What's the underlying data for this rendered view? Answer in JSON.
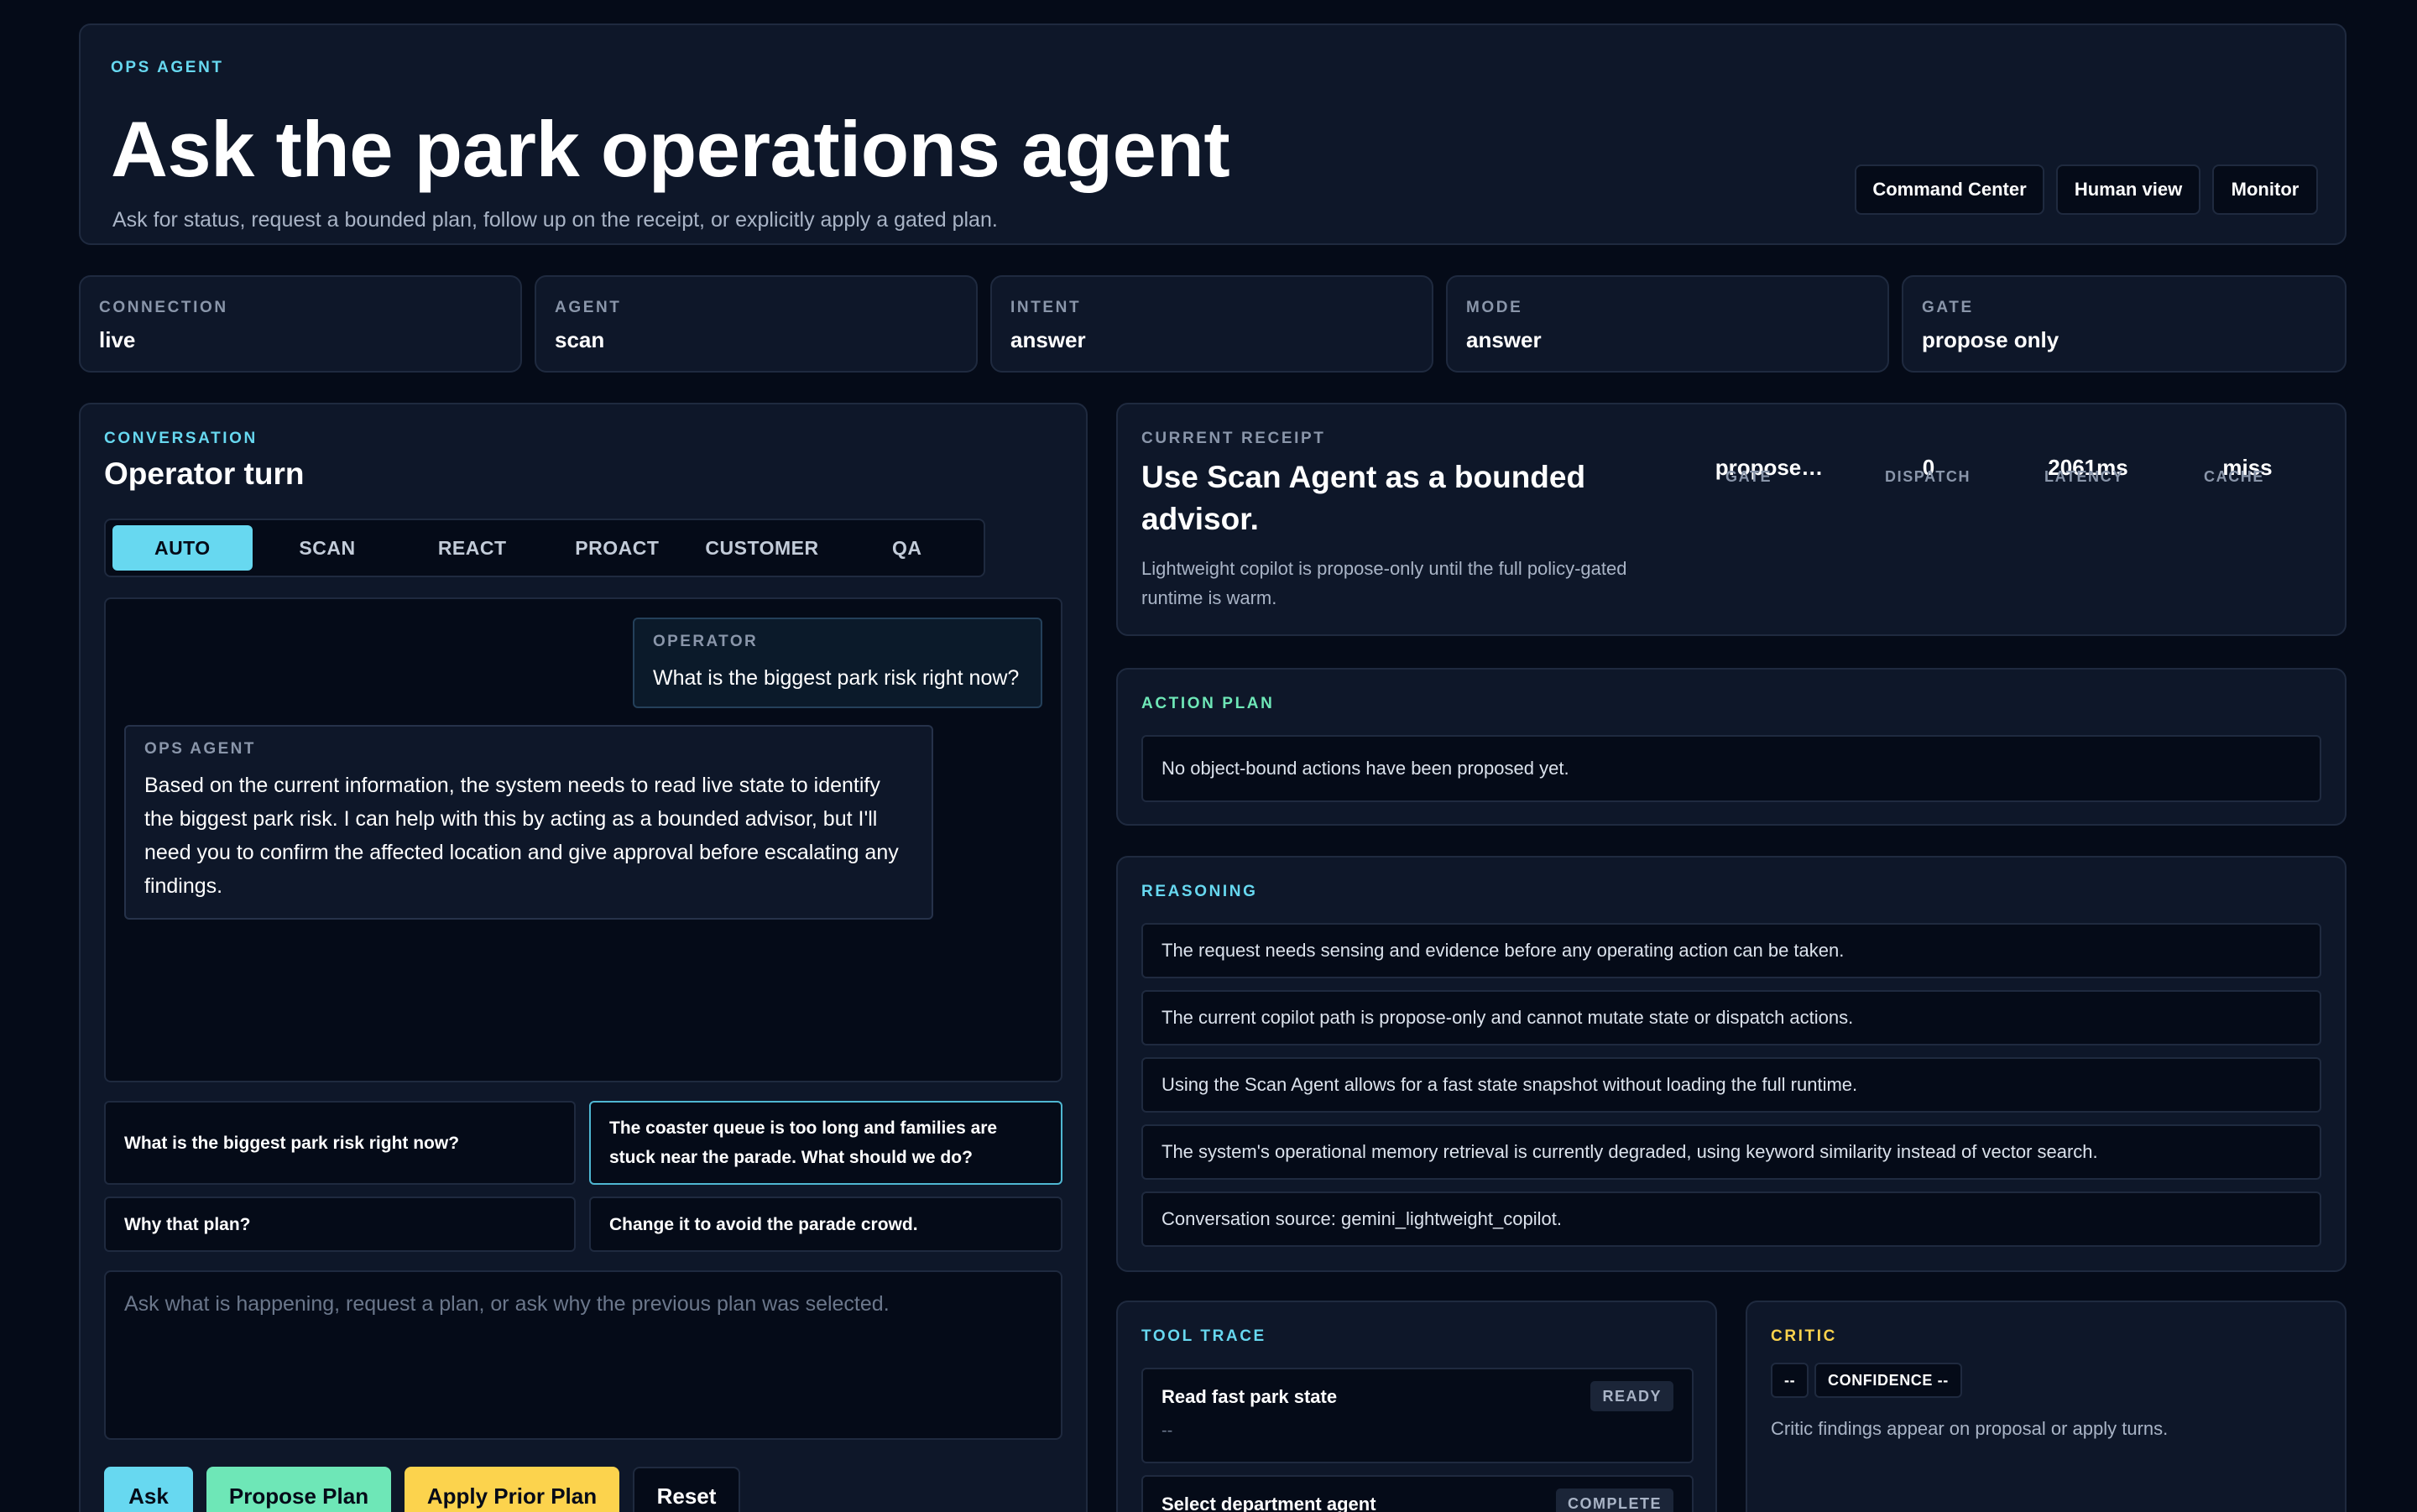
{
  "header": {
    "eyebrow": "OPS AGENT",
    "title": "Ask the park operations agent",
    "subtitle": "Ask for status, request a bounded plan, follow up on the receipt, or explicitly apply a gated plan.",
    "nav": [
      "Command Center",
      "Human view",
      "Monitor"
    ]
  },
  "stats": [
    {
      "label": "CONNECTION",
      "value": "live"
    },
    {
      "label": "AGENT",
      "value": "scan"
    },
    {
      "label": "INTENT",
      "value": "answer"
    },
    {
      "label": "MODE",
      "value": "answer"
    },
    {
      "label": "GATE",
      "value": "propose only"
    }
  ],
  "conversation": {
    "eyebrow": "CONVERSATION",
    "title": "Operator turn",
    "tabs": [
      "AUTO",
      "SCAN",
      "REACT",
      "PROACT",
      "CUSTOMER",
      "QA"
    ],
    "active_tab": "AUTO",
    "messages": [
      {
        "who": "OPERATOR",
        "text": "What is the biggest park risk right now?"
      },
      {
        "who": "OPS AGENT",
        "text": "Based on the current information, the system needs to read live state to identify the biggest park risk. I can help with this by acting as a bounded advisor, but I'll need you to confirm the affected location and give approval before escalating any findings."
      }
    ],
    "suggestions": [
      "What is the biggest park risk right now?",
      "The coaster queue is too long and families are stuck near the parade. What should we do?",
      "Why that plan?",
      "Change it to avoid the parade crowd."
    ],
    "composer_placeholder": "Ask what is happening, request a plan, or ask why the previous plan was selected.",
    "actions": [
      "Ask",
      "Propose Plan",
      "Apply Prior Plan",
      "Reset"
    ]
  },
  "receipt": {
    "eyebrow": "CURRENT RECEIPT",
    "title": "Use Scan Agent as a bounded advisor.",
    "description": "Lightweight copilot is propose-only until the full policy-gated runtime is warm.",
    "metrics": [
      {
        "label": "GATE",
        "value": "propose…"
      },
      {
        "label": "DISPATCH",
        "value": "0"
      },
      {
        "label": "LATENCY",
        "value": "2061ms"
      },
      {
        "label": "CACHE",
        "value": "miss"
      }
    ]
  },
  "action_plan": {
    "eyebrow": "ACTION PLAN",
    "empty_text": "No object-bound actions have been proposed yet."
  },
  "reasoning": {
    "eyebrow": "REASONING",
    "items": [
      "The request needs sensing and evidence before any operating action can be taken.",
      "The current copilot path is propose-only and cannot mutate state or dispatch actions.",
      "Using the Scan Agent allows for a fast state snapshot without loading the full runtime.",
      "The system's operational memory retrieval is currently degraded, using keyword similarity instead of vector search.",
      "Conversation source: gemini_lightweight_copilot."
    ]
  },
  "tool_trace": {
    "eyebrow": "TOOL TRACE",
    "tools": [
      {
        "name": "Read fast park state",
        "status": "READY",
        "detail": "--"
      },
      {
        "name": "Select department agent",
        "status": "COMPLETE",
        "detail": ""
      }
    ]
  },
  "critic": {
    "eyebrow": "CRITIC",
    "chip_a": "--",
    "chip_b": "CONFIDENCE --",
    "note": "Critic findings appear on proposal or apply turns."
  },
  "colors": {
    "accent_cyan": "#67d8f0",
    "accent_green": "#6ee7b7",
    "accent_yellow": "#fcd34d",
    "background": "#050b18",
    "panel": "#0e1729"
  }
}
